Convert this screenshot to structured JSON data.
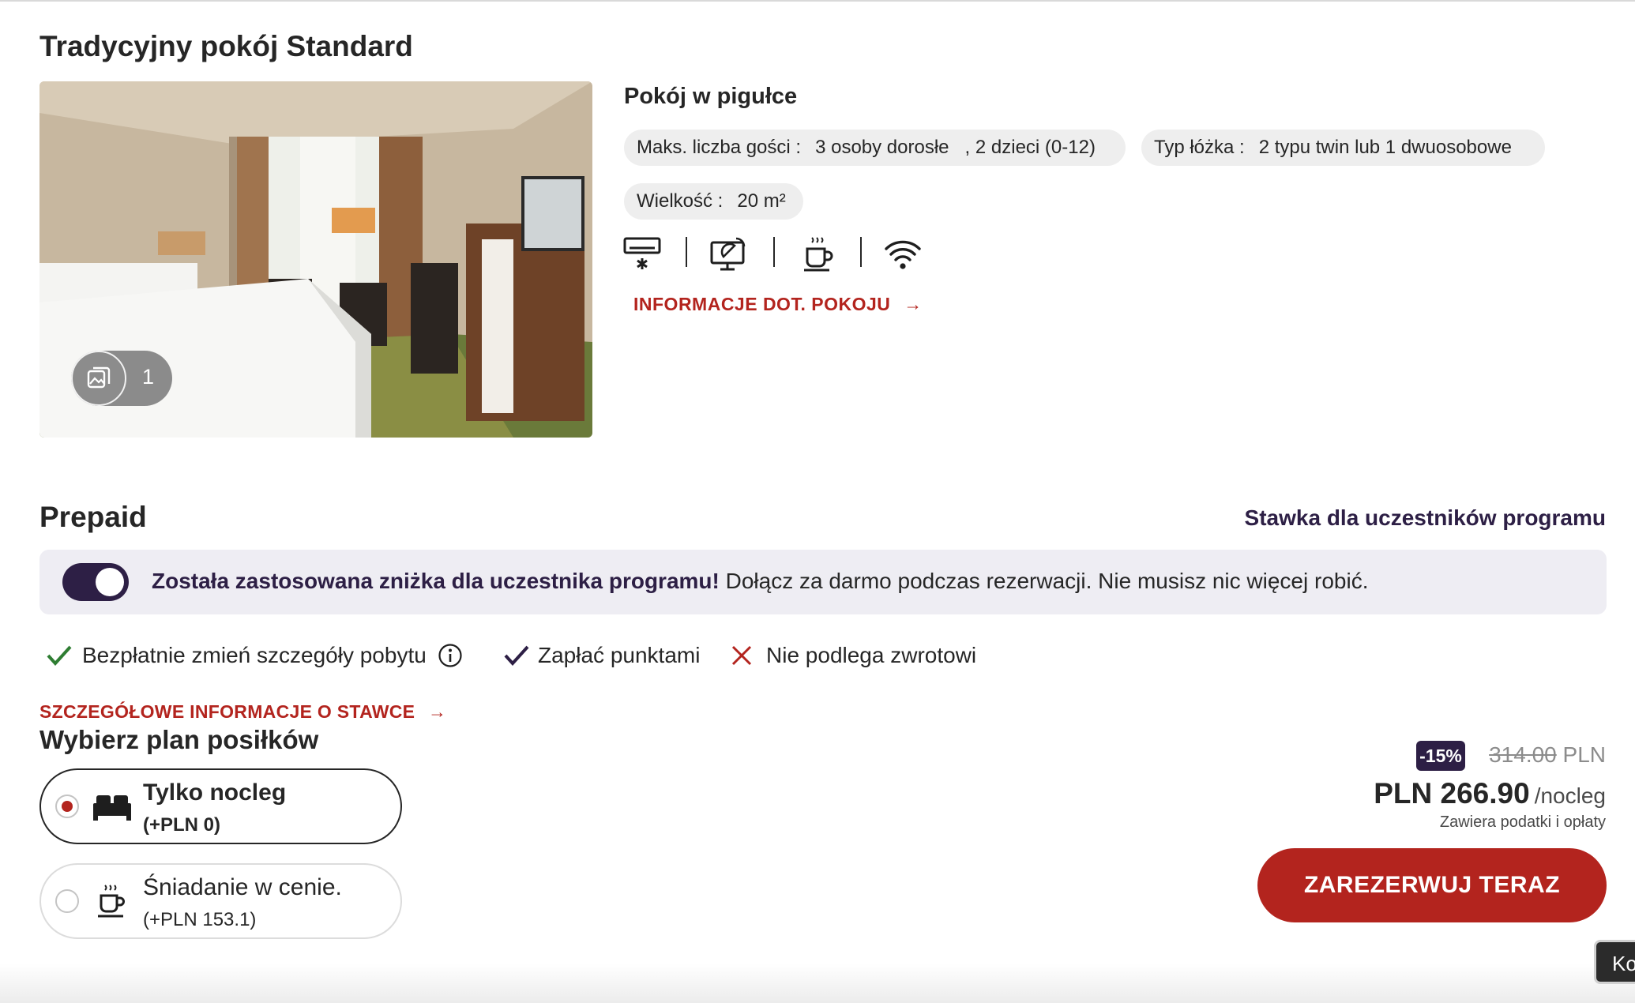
{
  "room": {
    "title": "Tradycyjny pokój Standard",
    "photo_count": "1",
    "nutshell_title": "Pokój w pigułce",
    "guests_label": "Maks. liczba gości :",
    "guests_adults": "3 osoby dorosłe",
    "guests_children": ", 2 dzieci (0-12)",
    "bed_label": "Typ łóżka :",
    "bed_value": "2 typu twin lub 1 dwuosobowe",
    "size_label": "Wielkość :",
    "size_value": "20 m²",
    "amenities": [
      "air-conditioner-icon",
      "satellite-tv-icon",
      "coffee-icon",
      "wifi-icon"
    ],
    "info_link": "INFORMACJE DOT. POKOJU"
  },
  "rate": {
    "title": "Prepaid",
    "member_rate": "Stawka dla uczestników programu",
    "banner_bold": "Została zastosowana zniżka dla uczestnika programu!",
    "banner_text": " Dołącz za darmo podczas rezerwacji. Nie musisz nic więcej robić.",
    "toggle_on": true,
    "benefits": [
      {
        "icon": "check-icon",
        "text": "Bezpłatnie zmień szczegóły pobytu",
        "has_info": true
      },
      {
        "icon": "check-icon",
        "text": "Zapłać punktami",
        "has_info": false
      },
      {
        "icon": "cross-icon",
        "text": "Nie podlega zwrotowi",
        "has_info": false
      }
    ],
    "details_link": "SZCZEGÓŁOWE INFORMACJE O STAWCE"
  },
  "meals": {
    "title": "Wybierz plan posiłków",
    "options": [
      {
        "name": "Tylko nocleg",
        "price": "(+PLN 0)",
        "icon": "bed-icon",
        "selected": true
      },
      {
        "name": "Śniadanie w cenie.",
        "price": "(+PLN 153.1)",
        "icon": "coffee-cup-icon",
        "selected": false
      }
    ]
  },
  "price": {
    "discount": "-15%",
    "old_amount": "314.00",
    "old_currency": "PLN",
    "current": "PLN 266.90",
    "unit": "/nocleg",
    "tax_note": "Zawiera podatki i opłaty",
    "book_label": "ZAREZERWUJ TERAZ"
  },
  "chat_tab": "Ko",
  "colors": {
    "brand_red": "#b3241e",
    "brand_purple": "#2d1f45",
    "check_green": "#2e7d32",
    "chip_bg": "#eeeeee"
  }
}
